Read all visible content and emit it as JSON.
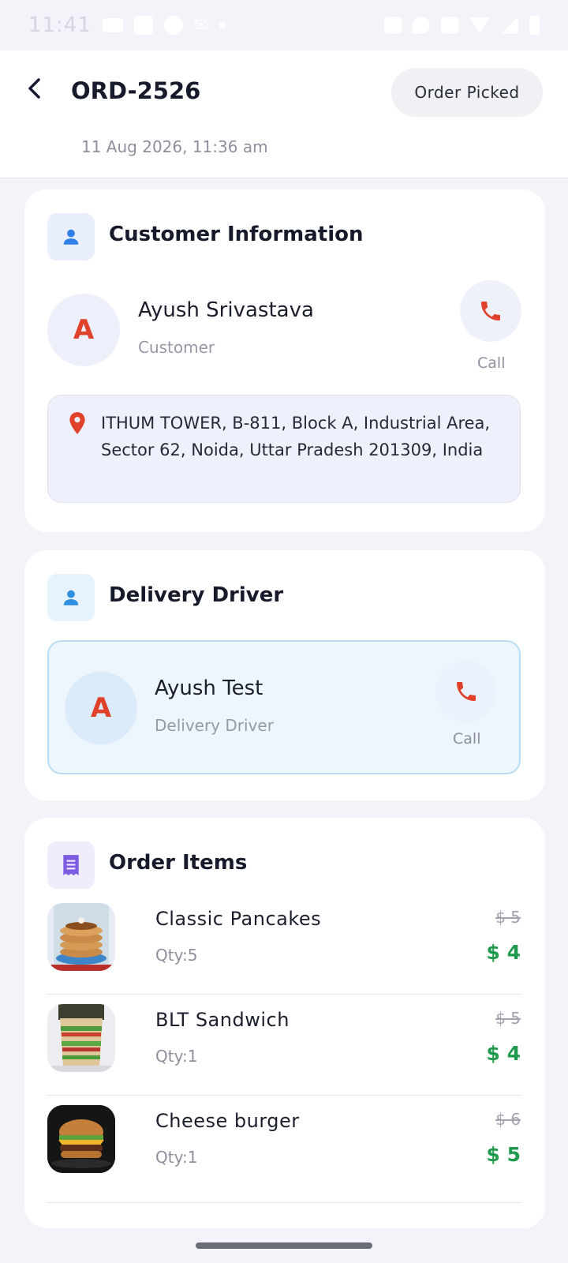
{
  "status_bar": {
    "time": "11:41",
    "icons": [
      "card-icon",
      "square-icon",
      "circle-icon",
      "mail-icon",
      "dot-icon",
      "data-icon",
      "location-icon",
      "wifi-call-icon",
      "wifi-icon",
      "signal-icon",
      "battery-icon"
    ]
  },
  "header": {
    "back_icon": "chevron-left-icon",
    "order_id": "ORD-2526",
    "status": "Order Picked",
    "date": "11 Aug 2026, 11:36 am"
  },
  "customer_card": {
    "title": "Customer Information",
    "icon": "person-icon",
    "avatar_letter": "A",
    "name": "Ayush Srivastava",
    "role": "Customer",
    "call_label": "Call",
    "address": "ITHUM TOWER, B-811, Block A, Industrial Area, Sector 62, Noida, Uttar Pradesh 201309, India"
  },
  "driver_card": {
    "title": "Delivery Driver",
    "icon": "person-icon",
    "avatar_letter": "A",
    "name": "Ayush Test",
    "role": "Delivery Driver",
    "call_label": "Call"
  },
  "items_card": {
    "title": "Order Items",
    "icon": "receipt-icon",
    "items": [
      {
        "name": "Classic Pancakes",
        "qty": "Qty:5",
        "old_price": "$ 5",
        "price": "$ 4",
        "image": "pancakes"
      },
      {
        "name": "BLT Sandwich",
        "qty": "Qty:1",
        "old_price": "$ 5",
        "price": "$ 4",
        "image": "sandwich"
      },
      {
        "name": "Cheese burger",
        "qty": "Qty:1",
        "old_price": "$ 6",
        "price": "$ 5",
        "image": "burger"
      }
    ]
  },
  "colors": {
    "accent_red": "#e0412b",
    "price_green": "#1f9b4d",
    "person_blue": "#2f7fe6",
    "receipt_purple": "#7b5ce0"
  }
}
